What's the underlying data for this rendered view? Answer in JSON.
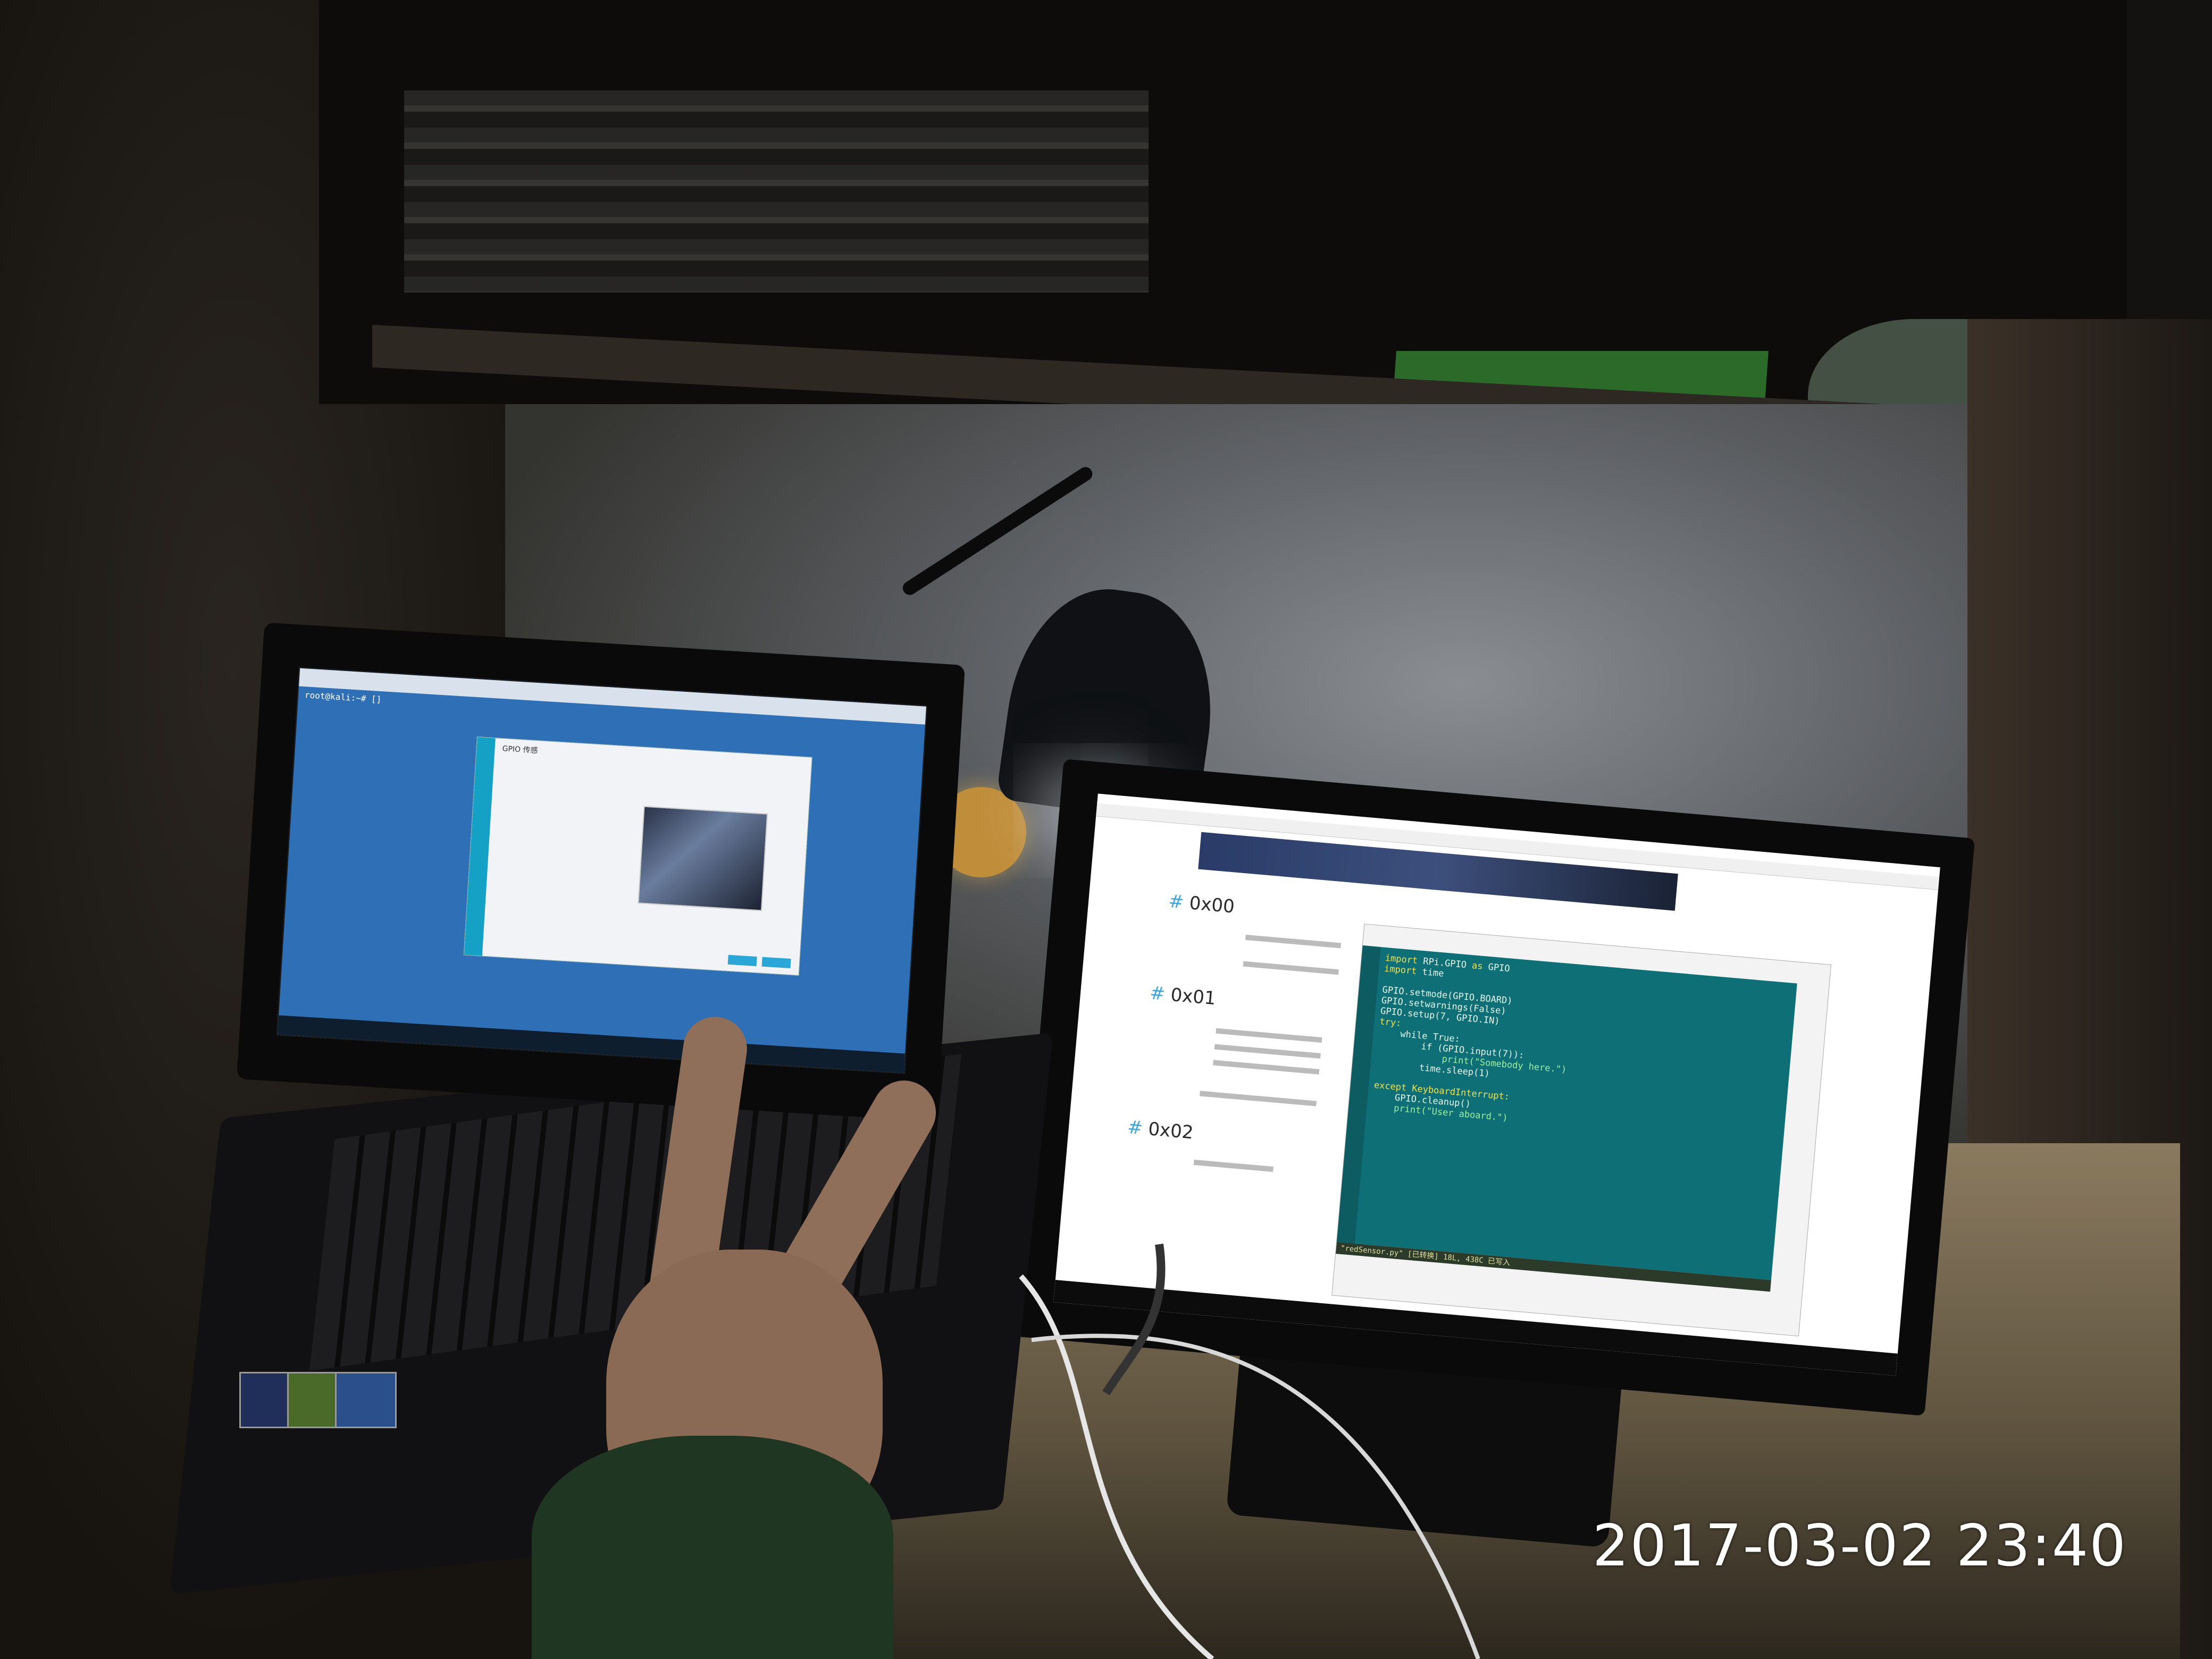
{
  "photo": {
    "timestamp": "2017-03-02 23:40"
  },
  "laptop": {
    "terminal_prompt": "root@kali:~# []",
    "window_title": "GPIO 传感"
  },
  "monitor": {
    "headings": [
      "0x00",
      "0x01",
      "0x02"
    ],
    "editor_lines": [
      "import RPi.GPIO as GPIO",
      "import time",
      "",
      "GPIO.setmode(GPIO.BOARD)",
      "GPIO.setwarnings(False)",
      "GPIO.setup(7, GPIO.IN)",
      "try:",
      "    while True:",
      "        if (GPIO.input(7)):",
      "            print(\"Somebody here.\")",
      "        time.sleep(1)",
      "",
      "except KeyboardInterrupt:",
      "    GPIO.cleanup()",
      "    print(\"User aboard.\")"
    ],
    "editor_status": "\"redSensor.py\" [已转换] 18L, 438C 已写入"
  },
  "colors": {
    "laptop_desktop": "#2f6fb5",
    "editor_bg": "#0e6f76",
    "heading_hash": "#3ea6d8"
  }
}
